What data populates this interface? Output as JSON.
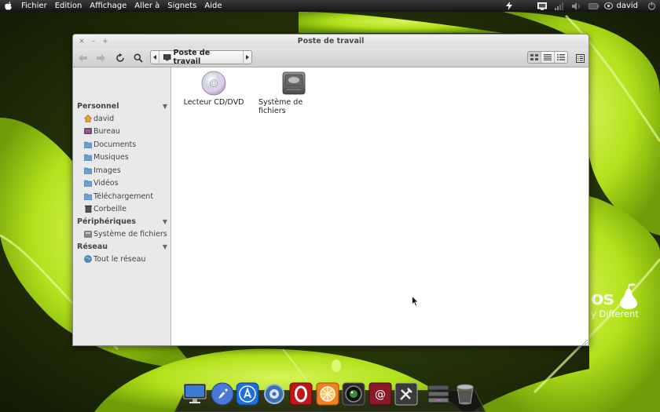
{
  "menubar": {
    "menus": [
      {
        "label": "Fichier"
      },
      {
        "label": "Edition"
      },
      {
        "label": "Affichage"
      },
      {
        "label": "Aller à"
      },
      {
        "label": "Signets"
      },
      {
        "label": "Aide"
      }
    ],
    "user": "david",
    "tray_icons": [
      "power-flash-icon",
      "display-icon",
      "signal-icon",
      "volume-icon",
      "battery-icon"
    ]
  },
  "window": {
    "title": "Poste de travail",
    "controls": [
      "close",
      "minimize",
      "maximize"
    ],
    "pathbar": {
      "crumb": "Poste de travail"
    },
    "view_modes": [
      "icon-view",
      "compact-view",
      "list-view"
    ],
    "active_view": "icon-view"
  },
  "sidebar": {
    "sections": [
      {
        "title": "Personnel",
        "items": [
          {
            "label": "david",
            "icon": "home-icon"
          },
          {
            "label": "Bureau",
            "icon": "desktop-icon"
          },
          {
            "label": "Documents",
            "icon": "folder-icon"
          },
          {
            "label": "Musiques",
            "icon": "folder-icon"
          },
          {
            "label": "Images",
            "icon": "folder-icon"
          },
          {
            "label": "Vidéos",
            "icon": "folder-icon"
          },
          {
            "label": "Téléchargement",
            "icon": "folder-icon"
          },
          {
            "label": "Corbeille",
            "icon": "trash-icon"
          }
        ]
      },
      {
        "title": "Périphériques",
        "items": [
          {
            "label": "Système de fichiers",
            "icon": "drive-icon"
          }
        ]
      },
      {
        "title": "Réseau",
        "items": [
          {
            "label": "Tout le réseau",
            "icon": "network-icon"
          }
        ]
      }
    ]
  },
  "content": {
    "files": [
      {
        "label": "Lecteur CD/DVD",
        "icon": "cd-dvd-icon"
      },
      {
        "label": "Système de fichiers",
        "icon": "hard-drive-icon"
      }
    ]
  },
  "desktop": {
    "brand": "os",
    "tagline": "y Different"
  },
  "dock": {
    "items": [
      "finder-icon",
      "launcher-rocket-icon",
      "app-store-icon",
      "settings-icon",
      "opera-icon",
      "orange-app-icon",
      "camera-icon",
      "mail-icon",
      "tools-icon",
      "stack-icon",
      "trash-icon"
    ]
  },
  "colors": {
    "leaf": "#b4e61e",
    "dark_bg": "#2a3a08",
    "menubar": "#1e1e1e",
    "sidebar": "#e9e9e9"
  }
}
